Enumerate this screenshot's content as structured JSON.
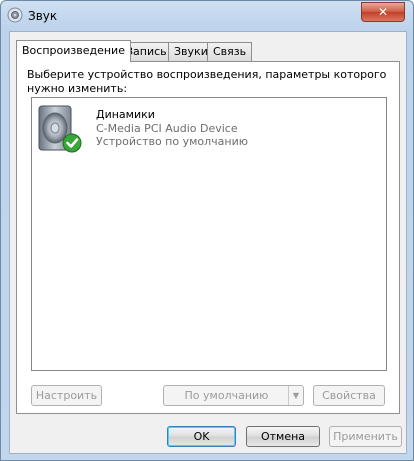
{
  "window": {
    "title": "Звук",
    "close_label": "✕",
    "icon": "speaker-title-icon"
  },
  "tabs": [
    {
      "label": "Воспроизведение",
      "active": true
    },
    {
      "label": "Запись",
      "active": false
    },
    {
      "label": "Звуки",
      "active": false
    },
    {
      "label": "Связь",
      "active": false
    }
  ],
  "panel": {
    "instruction": "Выберите устройство воспроизведения, параметры которого нужно изменить:",
    "devices": [
      {
        "name": "Динамики",
        "description": "C-Media PCI Audio Device",
        "status": "Устройство по умолчанию",
        "icon": "speaker-default-check-icon"
      }
    ],
    "configure_label": "Настроить",
    "set_default_label": "По умолчанию",
    "properties_label": "Свойства"
  },
  "footer": {
    "ok_label": "OK",
    "cancel_label": "Отмена",
    "apply_label": "Применить"
  }
}
